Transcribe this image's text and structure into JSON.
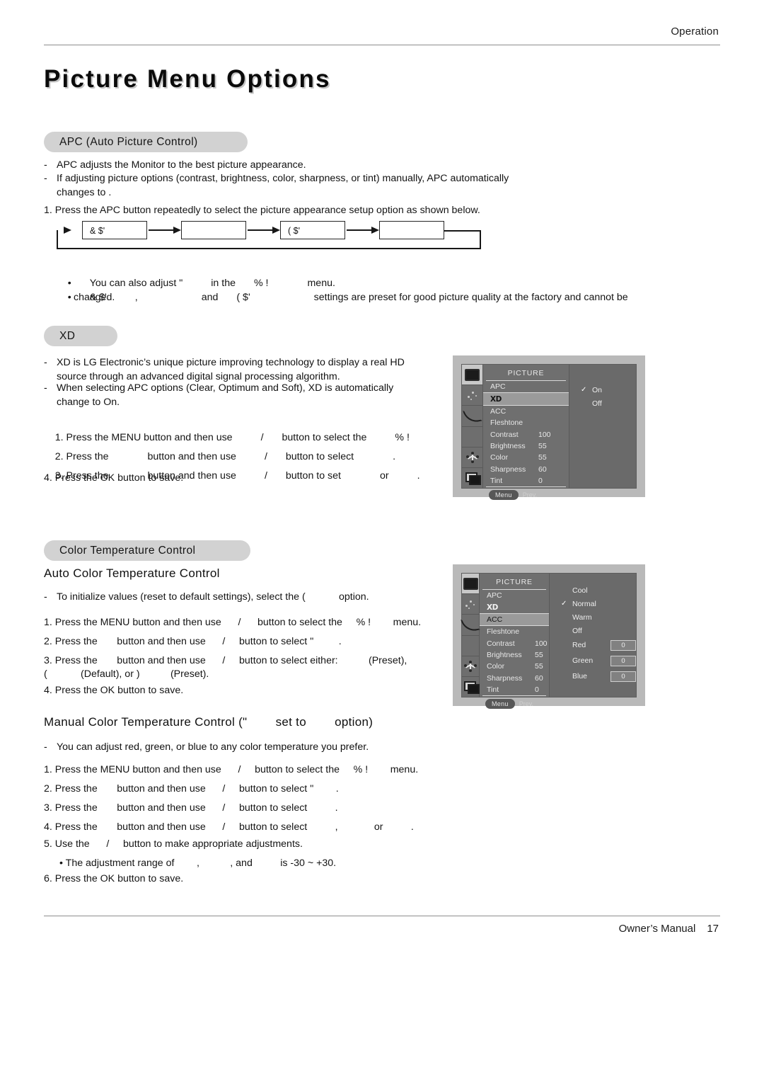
{
  "header": {
    "section_label": "Operation"
  },
  "footer": {
    "manual_label": "Owner’s Manual",
    "page_number": "17"
  },
  "page_title": "Picture Menu Options",
  "apc_section": {
    "pill_label": "APC (Auto Picture Control)",
    "bullets": [
      "APC adjusts the Monitor to the best picture appearance.",
      "If adjusting picture options (contrast, brightness, color, sharpness, or tint) manually, APC automatically"
    ],
    "bullet2_cont": "changes to        .",
    "step1": "1. Press the APC button repeatedly to select the picture appearance setup option as shown below.",
    "flow_boxes": [
      "& $'",
      "",
      "( $'",
      ""
    ],
    "note1_a": "You can also adjust \"",
    "note1_b": "in the",
    "note1_c": "% !",
    "note1_d": "menu.",
    "note2_a": "& $'",
    "note2_b": ",",
    "note2_c": "and",
    "note2_d": "( $'",
    "note2_e": "settings are preset for good picture quality at the factory and cannot be",
    "note2_cont": "changed."
  },
  "xd_section": {
    "pill_label": "XD",
    "bullets": [
      "XD is LG Electronic’s unique picture improving technology to display a real HD",
      "source through an advanced digital signal processing algorithm.",
      "When selecting APC options (Clear, Optimum and Soft), XD is automatically",
      "change to On."
    ],
    "steps": [
      {
        "n": "1. Press the MENU button and then use",
        "mid": "/",
        "tail": "button to select the",
        "token": "% !",
        "end": "menu."
      },
      {
        "n": "2. Press the",
        "blank": "",
        "mid": "button and then use",
        "slash": "/",
        "tail": "button to select",
        "end": "."
      },
      {
        "n": "3. Press the",
        "blank": "",
        "mid": "button and then use",
        "slash": "/",
        "tail": "button to set",
        "or": "or",
        "end": "."
      },
      {
        "n": "4. Press the OK button to save.",
        "mid": "",
        "tail": "",
        "end": ""
      }
    ]
  },
  "ctc_section": {
    "pill_label": "Color Temperature Control",
    "auto_heading": "Auto Color Temperature Control",
    "auto_bullet": "To initialize values (reset to default settings), select the (            option.",
    "auto_steps": [
      "1. Press the MENU button and then use      /      button to select the     % !        menu.",
      "2. Press the       button and then use      /     button to select \"         .",
      "3. Press the       button and then use      /     button to select either:           (Preset),",
      "(            (Default), or )           (Preset).",
      "4. Press the OK button to save."
    ],
    "manual_heading": "Manual Color Temperature Control (\"        set to        option)",
    "manual_bullet": "You can adjust red, green, or blue to any color temperature you prefer.",
    "manual_steps": [
      "1. Press the MENU button and then use      /     button to select the     % !        menu.",
      "2. Press the       button and then use      /     button to select \"        .",
      "3. Press the       button and then use      /     button to select          .",
      "4. Press the       button and then use      /     button to select          ,             or          .",
      "5. Use the      /     button to make appropriate adjustments.",
      "• The adjustment range of        ,           , and          is -30 ~ +30.",
      "6. Press the OK button to save."
    ]
  },
  "osd_xd": {
    "title": "PICTURE",
    "rail_icons": [
      "picture-icon",
      "sound-icon",
      "timer-arc-icon",
      "blank-icon",
      "setup-icon",
      "pip-icon"
    ],
    "rows": [
      {
        "label": "APC",
        "value": "",
        "selected": false
      },
      {
        "label": "XD",
        "value": "",
        "selected": true
      },
      {
        "label": "ACC",
        "value": "",
        "selected": false
      },
      {
        "label": "Fleshtone",
        "value": "",
        "selected": false
      },
      {
        "label": "Contrast",
        "value": "100",
        "selected": false
      },
      {
        "label": "Brightness",
        "value": "55",
        "selected": false
      },
      {
        "label": "Color",
        "value": "55",
        "selected": false
      },
      {
        "label": "Sharpness",
        "value": "60",
        "selected": false
      },
      {
        "label": "Tint",
        "value": "0",
        "selected": false
      }
    ],
    "menu_button": "Menu",
    "prev_label": "Prev.",
    "options": [
      {
        "label": "On",
        "checked": true
      },
      {
        "label": "Off",
        "checked": false
      }
    ]
  },
  "osd_acc": {
    "title": "PICTURE",
    "rail_icons": [
      "picture-icon",
      "sound-icon",
      "timer-arc-icon",
      "blank-icon",
      "setup-icon",
      "pip-icon"
    ],
    "rows": [
      {
        "label": "APC",
        "value": "",
        "selected": false
      },
      {
        "label": "XD",
        "value": "",
        "selected": false
      },
      {
        "label": "ACC",
        "value": "",
        "selected": true
      },
      {
        "label": "Fleshtone",
        "value": "",
        "selected": false
      },
      {
        "label": "Contrast",
        "value": "100",
        "selected": false
      },
      {
        "label": "Brightness",
        "value": "55",
        "selected": false
      },
      {
        "label": "Color",
        "value": "55",
        "selected": false
      },
      {
        "label": "Sharpness",
        "value": "60",
        "selected": false
      },
      {
        "label": "Tint",
        "value": "0",
        "selected": false
      }
    ],
    "menu_button": "Menu",
    "prev_label": "Prev.",
    "options": [
      {
        "label": "Cool",
        "checked": false
      },
      {
        "label": "Normal",
        "checked": true
      },
      {
        "label": "Warm",
        "checked": false
      },
      {
        "label": "Off",
        "checked": false
      },
      {
        "label": "Red",
        "checked": false,
        "value": "0"
      },
      {
        "label": "Green",
        "checked": false,
        "value": "0"
      },
      {
        "label": "Blue",
        "checked": false,
        "value": "0"
      }
    ]
  },
  "colors": {
    "pill_bg": "#d2d2d2",
    "osd_bezel": "#b9b9b9",
    "osd_body": "#787878",
    "osd_list": "#6f6f6f",
    "osd_panel": "#6a6a6a",
    "osd_selected_row": "#9a9a9a"
  }
}
